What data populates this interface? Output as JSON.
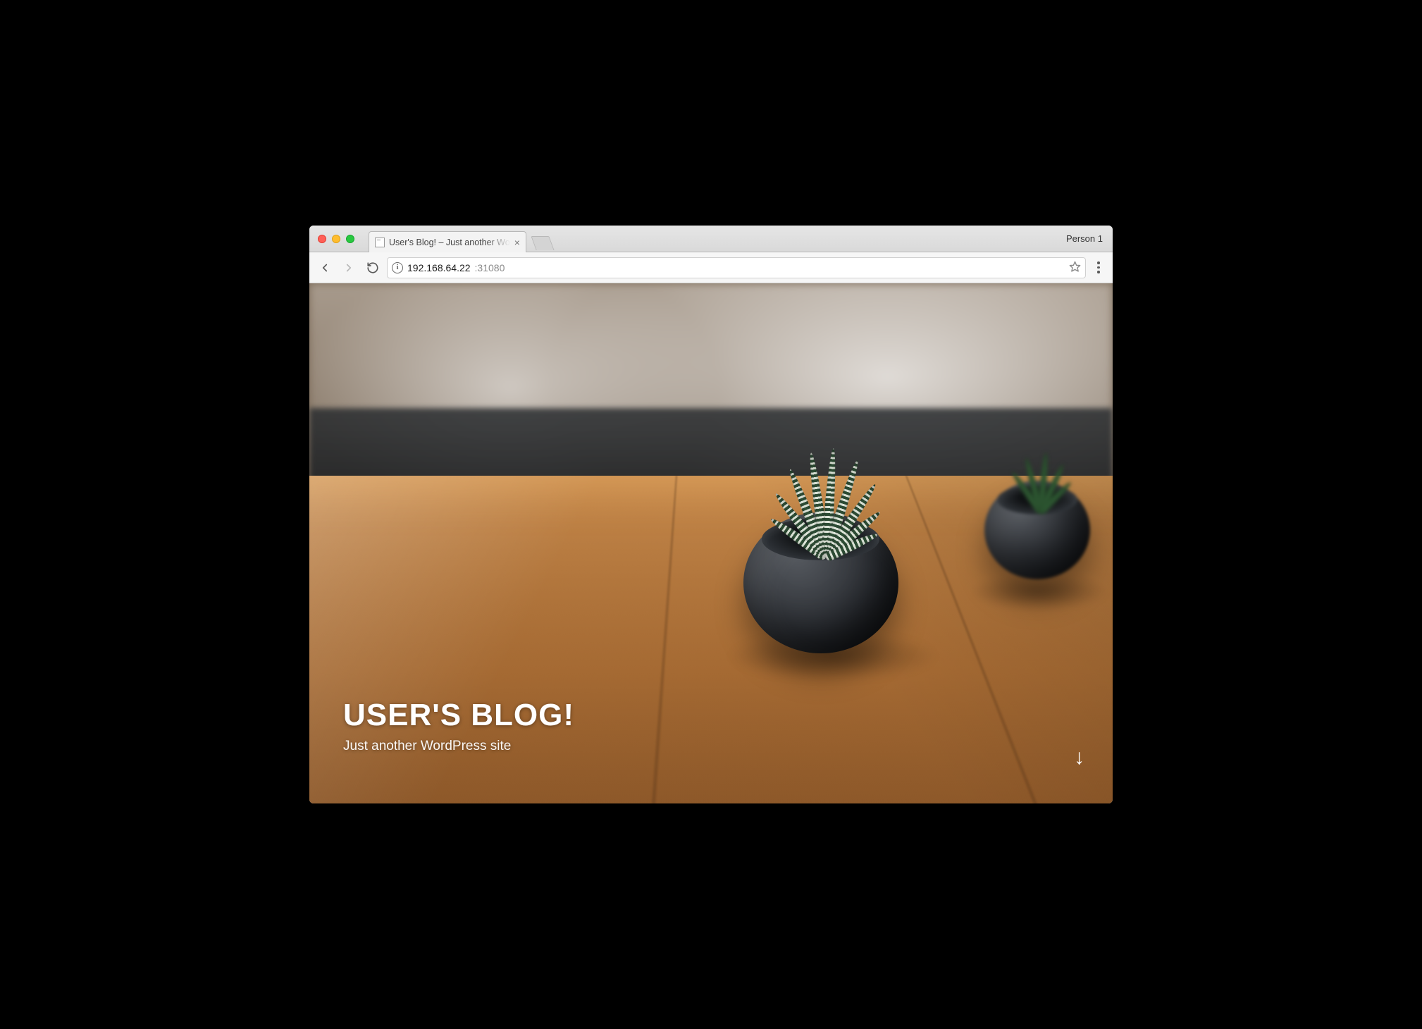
{
  "browser": {
    "tab_title": "User's Blog! – Just another Wo",
    "profile_label": "Person 1",
    "url_host": "192.168.64.22",
    "url_port": ":31080"
  },
  "page": {
    "site_title": "USER'S BLOG!",
    "tagline": "Just another WordPress site",
    "scroll_arrow": "↓"
  }
}
